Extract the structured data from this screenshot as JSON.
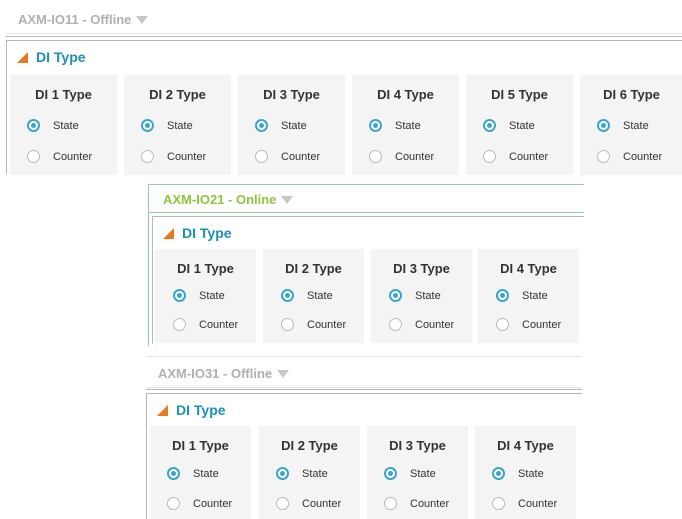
{
  "modules": [
    {
      "name": "AXM-IO11 - Offline",
      "section_title": "DI Type",
      "cards": [
        {
          "title": "DI 1 Type",
          "options": [
            "State",
            "Counter"
          ],
          "selected": "State"
        },
        {
          "title": "DI 2 Type",
          "options": [
            "State",
            "Counter"
          ],
          "selected": "State"
        },
        {
          "title": "DI 3 Type",
          "options": [
            "State",
            "Counter"
          ],
          "selected": "State"
        },
        {
          "title": "DI 4 Type",
          "options": [
            "State",
            "Counter"
          ],
          "selected": "State"
        },
        {
          "title": "DI 5 Type",
          "options": [
            "State",
            "Counter"
          ],
          "selected": "State"
        },
        {
          "title": "DI 6 Type",
          "options": [
            "State",
            "Counter"
          ],
          "selected": "State"
        }
      ]
    },
    {
      "name": "AXM-IO21 - Online",
      "section_title": "DI Type",
      "cards": [
        {
          "title": "DI 1 Type",
          "options": [
            "State",
            "Counter"
          ],
          "selected": "State"
        },
        {
          "title": "DI 2 Type",
          "options": [
            "State",
            "Counter"
          ],
          "selected": "State"
        },
        {
          "title": "DI 3 Type",
          "options": [
            "State",
            "Counter"
          ],
          "selected": "State"
        },
        {
          "title": "DI 4 Type",
          "options": [
            "State",
            "Counter"
          ],
          "selected": "State"
        }
      ]
    },
    {
      "name": "AXM-IO31 - Offline",
      "section_title": "DI Type",
      "cards": [
        {
          "title": "DI 1 Type",
          "options": [
            "State",
            "Counter"
          ],
          "selected": "State"
        },
        {
          "title": "DI 2 Type",
          "options": [
            "State",
            "Counter"
          ],
          "selected": "State"
        },
        {
          "title": "DI 3 Type",
          "options": [
            "State",
            "Counter"
          ],
          "selected": "State"
        },
        {
          "title": "DI 4 Type",
          "options": [
            "State",
            "Counter"
          ],
          "selected": "State"
        }
      ]
    }
  ],
  "colors": {
    "online": "#8cc63f",
    "offline": "#b0b0b0",
    "section_title": "#1a8fb8",
    "triangle": "#e8791d",
    "radio_selected": "#3aa6c9"
  }
}
